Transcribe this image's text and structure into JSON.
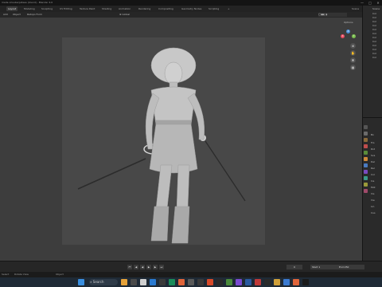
{
  "window": {
    "title": "made orlusberjuiteau (blend) - Blender 4.0",
    "controls": [
      "—",
      "□",
      "✕"
    ]
  },
  "menubar": {
    "tabs": [
      "Layout",
      "Modeling",
      "Sculpting",
      "UV Editing",
      "Texture Paint",
      "Shading",
      "Animation",
      "Rendering",
      "Compositing",
      "Geometry Nodes",
      "Scripting",
      "+"
    ],
    "scene_label": "Scene"
  },
  "toolbar": {
    "items": [
      "Add",
      "Object",
      "Retopo Form"
    ],
    "transform": "Global",
    "options_label": "Options"
  },
  "outliner": {
    "rows": [
      "Scene",
      "Col",
      "Col",
      "Col",
      "Col",
      "Col",
      "Col",
      "Col",
      "Col",
      "Col",
      "Col",
      "Col",
      "Col"
    ]
  },
  "properties": {
    "rows": [
      "Bo",
      "Tra",
      "Rot",
      "Sca",
      "Del",
      "Rel",
      "Col",
      "Ins",
      "Mot",
      "Vis",
      "Vie",
      "Lin",
      "Cus"
    ]
  },
  "timeline": {
    "current_frame": "0",
    "start_label": "Start",
    "start_value": "1",
    "end_label": "End",
    "end_value": "250",
    "play_buttons": [
      "⏮",
      "◀",
      "◀",
      "▶",
      "▶",
      "⏭"
    ]
  },
  "status": {
    "left": "Select",
    "mid": "Rotate View",
    "right": "Object"
  },
  "taskbar": {
    "search_placeholder": "Search"
  },
  "colors": {
    "accent": "#4772b3",
    "x_axis": "#e84a5f",
    "y_axis": "#7bbf4f",
    "z_axis": "#4a8fd6"
  }
}
